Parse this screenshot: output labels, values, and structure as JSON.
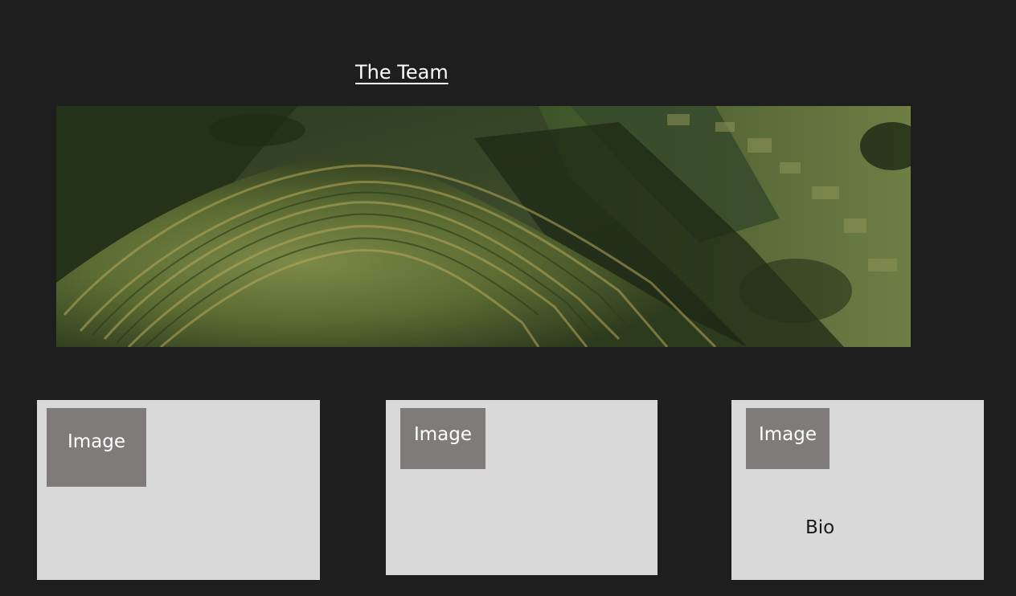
{
  "header": {
    "title": "The Team"
  },
  "hero": {
    "alt": "terraced-hillside-landscape-photo"
  },
  "cards": [
    {
      "image_label": "Image",
      "bio": ""
    },
    {
      "image_label": "Image",
      "bio": ""
    },
    {
      "image_label": "Image",
      "bio": "Bio"
    }
  ],
  "colors": {
    "background": "#1e1e1e",
    "card": "#d9d9d9",
    "image_placeholder": "#807b7b",
    "text_light": "#ffffff"
  }
}
